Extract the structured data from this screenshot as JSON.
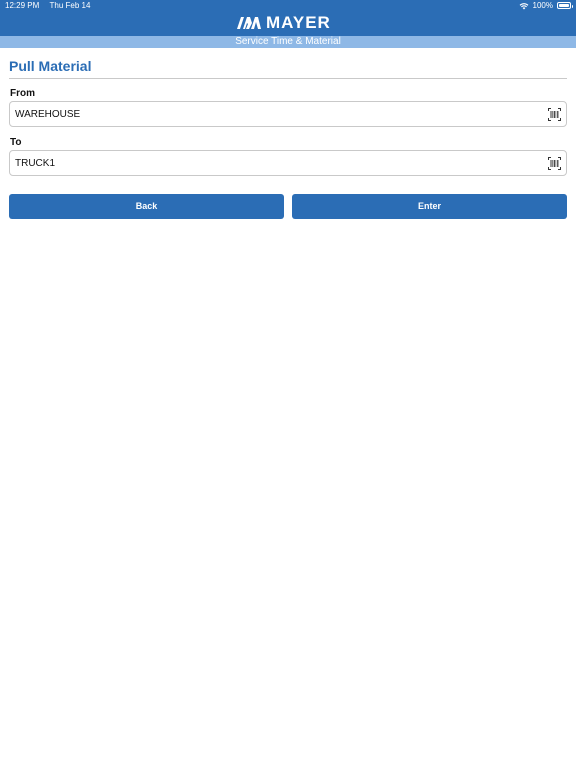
{
  "status_bar": {
    "time": "12:29 PM",
    "date": "Thu Feb 14",
    "battery": "100%",
    "battery_level": 1.0,
    "wifi_icon": "wifi-icon",
    "battery_icon": "battery-icon"
  },
  "brand": {
    "logo_text": "MAYER",
    "subtitle": "Service Time & Material"
  },
  "page": {
    "title": "Pull Material"
  },
  "form": {
    "from": {
      "label": "From",
      "value": "WAREHOUSE",
      "icon": "barcode-scan-icon"
    },
    "to": {
      "label": "To",
      "value": "TRUCK1",
      "icon": "barcode-scan-icon"
    }
  },
  "buttons": {
    "back_label": "Back",
    "enter_label": "Enter"
  },
  "colors": {
    "primary": "#2b6db5",
    "subheader": "#8eb8e6",
    "border": "#c9c9c9"
  }
}
